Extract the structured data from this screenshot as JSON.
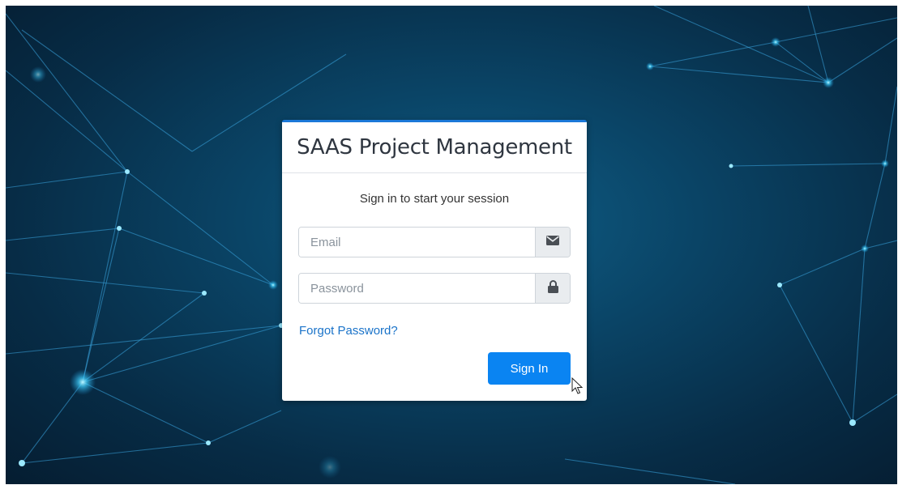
{
  "login": {
    "title": "SAAS Project Management",
    "subtitle": "Sign in to start your session",
    "email_placeholder": "Email",
    "password_placeholder": "Password",
    "forgot_link": "Forgot Password?",
    "signin_label": "Sign In"
  },
  "icons": {
    "email": "envelope-icon",
    "password": "lock-icon"
  },
  "colors": {
    "accent": "#0a84f2",
    "link": "#1a73c9",
    "card_top_border": "#1b78d8",
    "background": "#072c46"
  }
}
